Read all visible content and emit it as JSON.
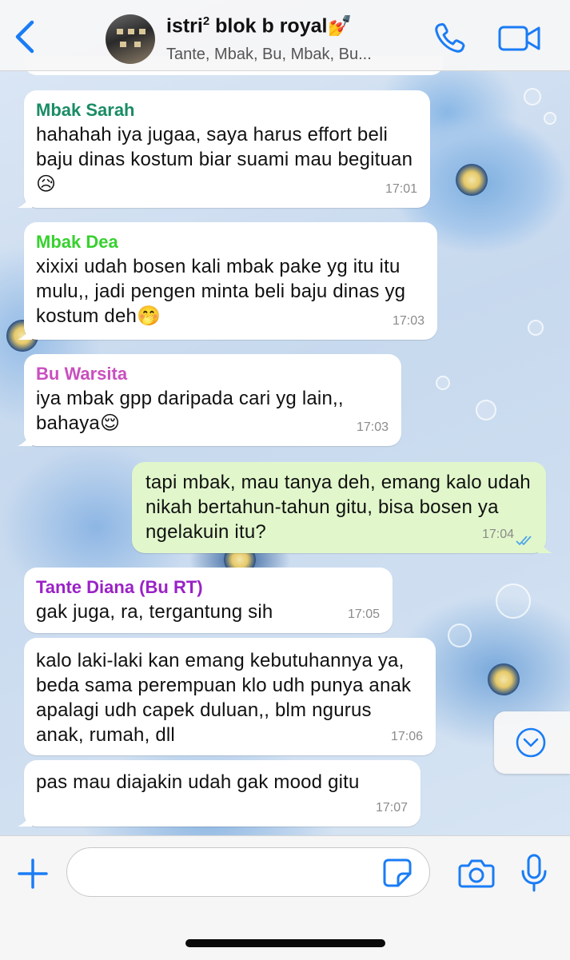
{
  "header": {
    "title": "istri",
    "title_sup": "2",
    "title_rest": " blok b royal",
    "title_emoji": "💅",
    "members": "Tante, Mbak, Bu, Mbak, Bu..."
  },
  "colors": {
    "accent": "#1a7cf5",
    "outgoing_bubble": "#e1f7cb",
    "incoming_bubble": "#ffffff"
  },
  "messages": [
    {
      "sender": "Mbak Sarah",
      "sender_color": "#1a8c64",
      "text": "hahahah iya jugaa, saya harus effort beli baju dinas kostum biar suami mau begituan😥",
      "time": "17:01"
    },
    {
      "sender": "Mbak Dea",
      "sender_color": "#37d12f",
      "text": "xixixi udah bosen kali mbak pake yg itu itu mulu,, jadi pengen minta beli baju dinas yg kostum deh🤭",
      "time": "17:03"
    },
    {
      "sender": "Bu Warsita",
      "sender_color": "#c94fbf",
      "text": "iya mbak gpp daripada cari yg lain,, bahaya😌",
      "time": "17:03"
    },
    {
      "sender": "",
      "text": "tapi mbak, mau tanya deh, emang kalo udah nikah bertahun-tahun gitu, bisa bosen ya ngelakuin itu?",
      "time": "17:04"
    },
    {
      "sender": "Tante Diana (Bu RT)",
      "sender_color": "#9a22c6",
      "text": "gak juga, ra, tergantung sih",
      "time": "17:05"
    },
    {
      "sender": "",
      "text": "kalo laki-laki kan emang kebutuhannya ya, beda sama perempuan klo udh punya anak apalagi udh capek duluan,, blm ngurus anak, rumah, dll",
      "time": "17:06"
    },
    {
      "sender": "",
      "text": "pas mau diajakin udah gak mood gitu",
      "time": "17:07"
    }
  ],
  "input": {
    "value": "",
    "placeholder": ""
  },
  "icons": {
    "back": "chevron-left-icon",
    "call": "phone-icon",
    "video": "video-camera-icon",
    "scroll": "chevron-down-circle-icon",
    "plus": "plus-icon",
    "sticker": "sticker-icon",
    "camera": "camera-icon",
    "mic": "microphone-icon"
  }
}
